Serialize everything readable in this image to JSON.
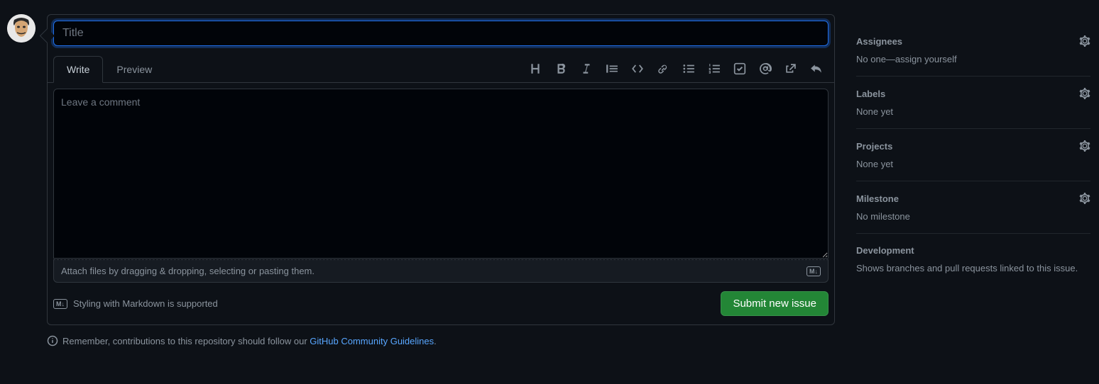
{
  "form": {
    "title_placeholder": "Title",
    "comment_placeholder": "Leave a comment",
    "attach_text": "Attach files by dragging & dropping, selecting or pasting them.",
    "markdown_support": "Styling with Markdown is supported",
    "submit_label": "Submit new issue"
  },
  "tabs": {
    "write": "Write",
    "preview": "Preview"
  },
  "guidelines": {
    "prefix": "Remember, contributions to this repository should follow our ",
    "link_text": "GitHub Community Guidelines",
    "suffix": "."
  },
  "sidebar": {
    "assignees": {
      "title": "Assignees",
      "value_prefix": "No one—",
      "link": "assign yourself"
    },
    "labels": {
      "title": "Labels",
      "value": "None yet"
    },
    "projects": {
      "title": "Projects",
      "value": "None yet"
    },
    "milestone": {
      "title": "Milestone",
      "value": "No milestone"
    },
    "development": {
      "title": "Development",
      "value": "Shows branches and pull requests linked to this issue."
    }
  }
}
